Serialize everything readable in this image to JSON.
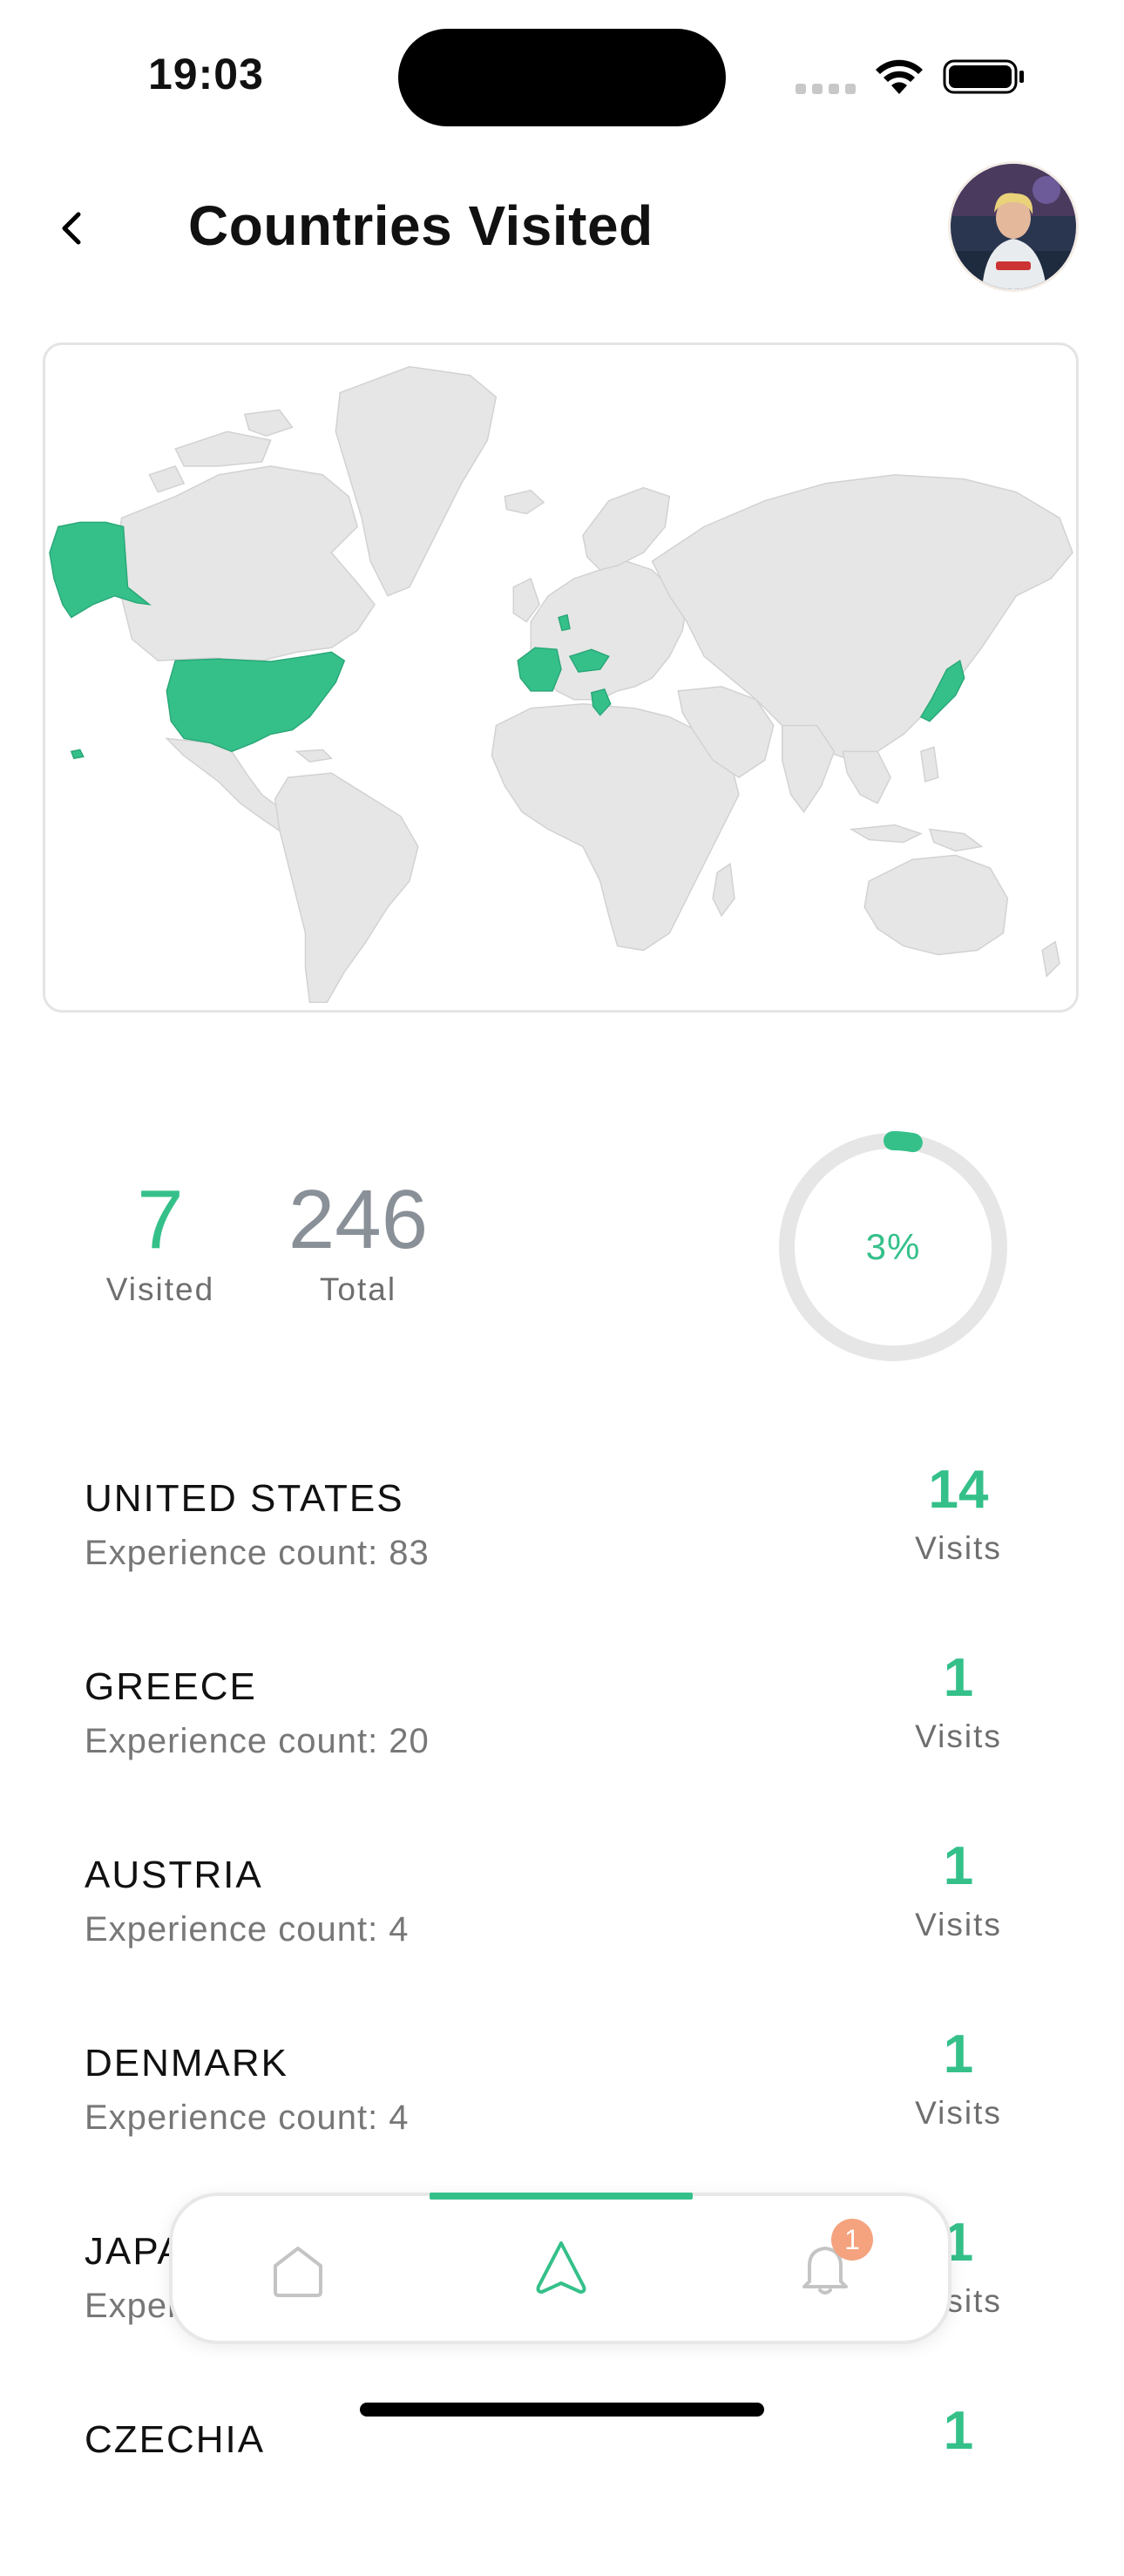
{
  "status_bar": {
    "time": "19:03"
  },
  "header": {
    "title": "Countries Visited",
    "back_icon": "chevron-left-icon",
    "avatar": "user-avatar-photo"
  },
  "map": {
    "visited_color": "#35c08a",
    "land_color": "#e6e6e6",
    "highlighted_countries": [
      "United States",
      "Greece",
      "Austria",
      "Denmark",
      "Japan",
      "Czechia",
      "France"
    ]
  },
  "stats": {
    "visited_value": "7",
    "visited_label": "Visited",
    "total_value": "246",
    "total_label": "Total",
    "percent_text": "3%",
    "percent_fraction": 0.03,
    "accent_color": "#35c08a"
  },
  "countries": [
    {
      "name": "UNITED STATES",
      "experience": "Experience count: 83",
      "visits": "14",
      "visits_label": "Visits"
    },
    {
      "name": "GREECE",
      "experience": "Experience count: 20",
      "visits": "1",
      "visits_label": "Visits"
    },
    {
      "name": "AUSTRIA",
      "experience": "Experience count: 4",
      "visits": "1",
      "visits_label": "Visits"
    },
    {
      "name": "DENMARK",
      "experience": "Experience count: 4",
      "visits": "1",
      "visits_label": "Visits"
    },
    {
      "name": "JAPAN",
      "experience": "Experience count: 4",
      "visits": "1",
      "visits_label": "Visits"
    },
    {
      "name": "CZECHIA",
      "experience": "",
      "visits": "1",
      "visits_label": ""
    }
  ],
  "bottom_nav": {
    "items": [
      {
        "icon": "home-icon",
        "active": false
      },
      {
        "icon": "explore-icon",
        "active": true
      },
      {
        "icon": "bell-icon",
        "active": false
      }
    ],
    "notification_badge": "1"
  }
}
